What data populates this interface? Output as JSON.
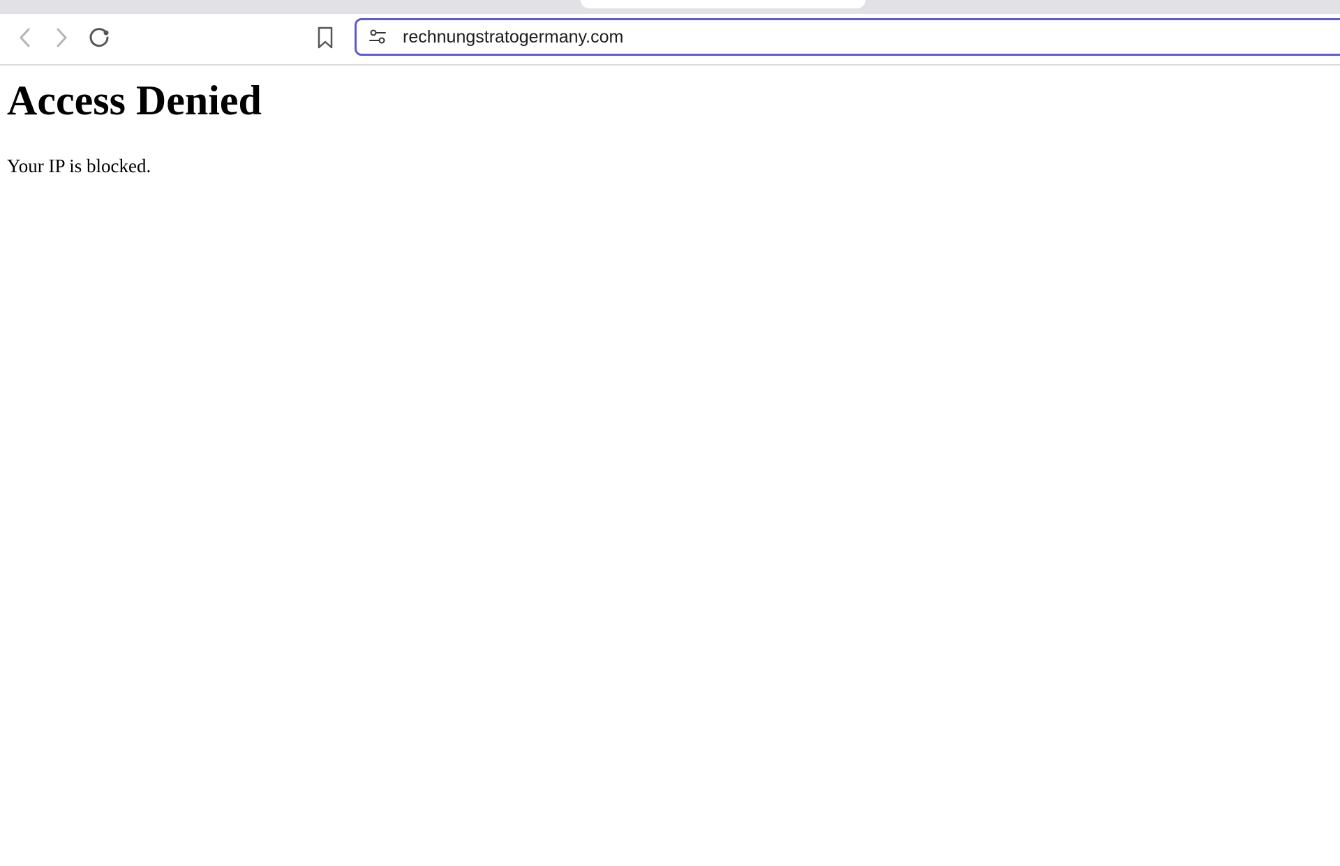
{
  "browser": {
    "toolbar": {
      "back_icon": "chevron-left-icon",
      "forward_icon": "chevron-right-icon",
      "reload_icon": "reload-icon",
      "bookmark_icon": "bookmark-icon"
    },
    "address_bar": {
      "settings_icon": "site-settings-icon",
      "url": "rechnungstratogermany.com",
      "focus_color": "#5b5bd6"
    }
  },
  "page": {
    "title": "Access Denied",
    "message": "Your IP is blocked."
  }
}
